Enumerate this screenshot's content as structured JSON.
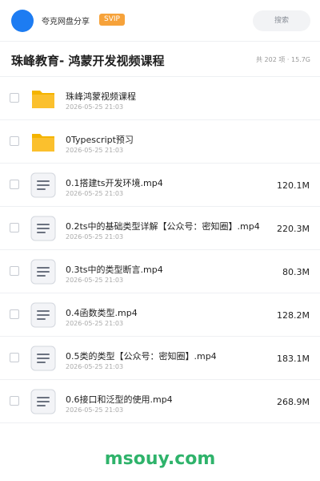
{
  "header": {
    "user_name": "夸克网盘分享",
    "badge": "SVIP",
    "search_label": "搜索"
  },
  "folder": {
    "title": "珠峰教育- 鸿蒙开发视频课程",
    "stats": "共 202 项 · 15.7G"
  },
  "items": [
    {
      "type": "folder",
      "icon": "folder-icon",
      "name": "珠峰鸿蒙视频课程",
      "date": "2026-05-25 21:03",
      "size": ""
    },
    {
      "type": "folder",
      "icon": "folder-icon",
      "name": "0Typescript预习",
      "date": "2026-05-25 21:03",
      "size": ""
    },
    {
      "type": "file",
      "icon": "video-file-icon",
      "name": "0.1搭建ts开发环境.mp4",
      "date": "2026-05-25 21:03",
      "size": "120.1M"
    },
    {
      "type": "file",
      "icon": "video-file-icon",
      "name": "0.2ts中的基础类型详解【公众号：密知圈】.mp4",
      "date": "2026-05-25 21:03",
      "size": "220.3M"
    },
    {
      "type": "file",
      "icon": "video-file-icon",
      "name": "0.3ts中的类型断言.mp4",
      "date": "2026-05-25 21:03",
      "size": "80.3M"
    },
    {
      "type": "file",
      "icon": "video-file-icon",
      "name": "0.4函数类型.mp4",
      "date": "2026-05-25 21:03",
      "size": "128.2M"
    },
    {
      "type": "file",
      "icon": "video-file-icon",
      "name": "0.5类的类型【公众号：密知圈】.mp4",
      "date": "2026-05-25 21:03",
      "size": "183.1M"
    },
    {
      "type": "file",
      "icon": "video-file-icon",
      "name": "0.6接口和泛型的使用.mp4",
      "date": "2026-05-25 21:03",
      "size": "268.9M"
    }
  ],
  "watermark": "msouy.com",
  "colors": {
    "accent": "#1d7cf2",
    "badge": "#f6a23a",
    "folder": "#fbc02d",
    "watermark": "#2fb36b"
  }
}
